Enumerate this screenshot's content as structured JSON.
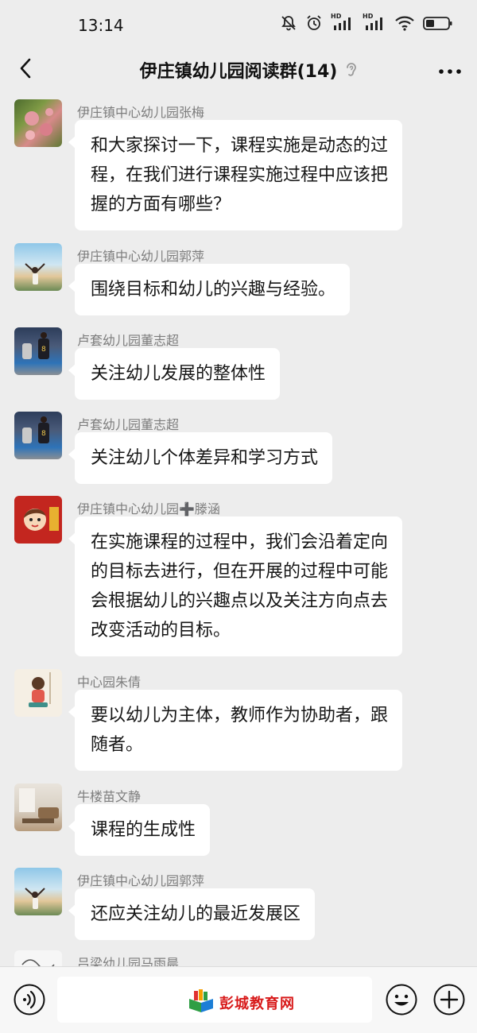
{
  "status_bar": {
    "time": "13:14",
    "icons": [
      "mute-bell-icon",
      "alarm-icon",
      "hd-signal-icon",
      "hd-signal-icon",
      "wifi-icon",
      "battery-icon"
    ],
    "network_badges": [
      "HD",
      "HD"
    ]
  },
  "header": {
    "title": "伊庄镇幼儿园阅读群(14)",
    "back_icon": "chevron-left-icon",
    "ear_icon": "earpiece-icon",
    "more_icon": "more-dots-icon"
  },
  "messages": [
    {
      "sender": "伊庄镇中心幼儿园张梅",
      "text": "和大家探讨一下，课程实施是动态的过程，在我们进行课程实施过程中应该把握的方面有哪些？",
      "avatar": "flower-avatar"
    },
    {
      "sender": "伊庄镇中心幼儿园郭萍",
      "text": "围绕目标和幼儿的兴趣与经验。",
      "avatar": "sky-girl-avatar"
    },
    {
      "sender": "卢套幼儿园董志超",
      "text": "关注幼儿发展的整体性",
      "avatar": "basketball-avatar"
    },
    {
      "sender": "卢套幼儿园董志超",
      "text": "关注幼儿个体差异和学习方式",
      "avatar": "basketball-avatar"
    },
    {
      "sender": "伊庄镇中心幼儿园➕滕涵",
      "text": "在实施课程的过程中，我们会沿着定向的目标去进行，但在开展的过程中可能会根据幼儿的兴趣点以及关注方向点去改变活动的目标。",
      "avatar": "cartoon-girl-avatar"
    },
    {
      "sender": "中心园朱倩",
      "text": "要以幼儿为主体，教师作为协助者，跟随者。",
      "avatar": "cartoon-scale-avatar"
    },
    {
      "sender": "牛楼苗文静",
      "text": "课程的生成性",
      "avatar": "room-avatar"
    },
    {
      "sender": "伊庄镇中心幼儿园郭萍",
      "text": "还应关注幼儿的最近发展区",
      "avatar": "sky-girl-avatar"
    },
    {
      "sender": "吕梁幼儿园马雨晨",
      "text": "",
      "avatar": "sketch-avatar"
    }
  ],
  "bottom_bar": {
    "voice_icon": "voice-icon",
    "watermark_text": "彭城教育网",
    "emoji_icon": "emoji-icon",
    "plus_icon": "plus-icon"
  },
  "colors": {
    "background": "#ededed",
    "bubble": "#ffffff",
    "sender": "#7d7d7d",
    "watermark": "#d81b1b"
  }
}
